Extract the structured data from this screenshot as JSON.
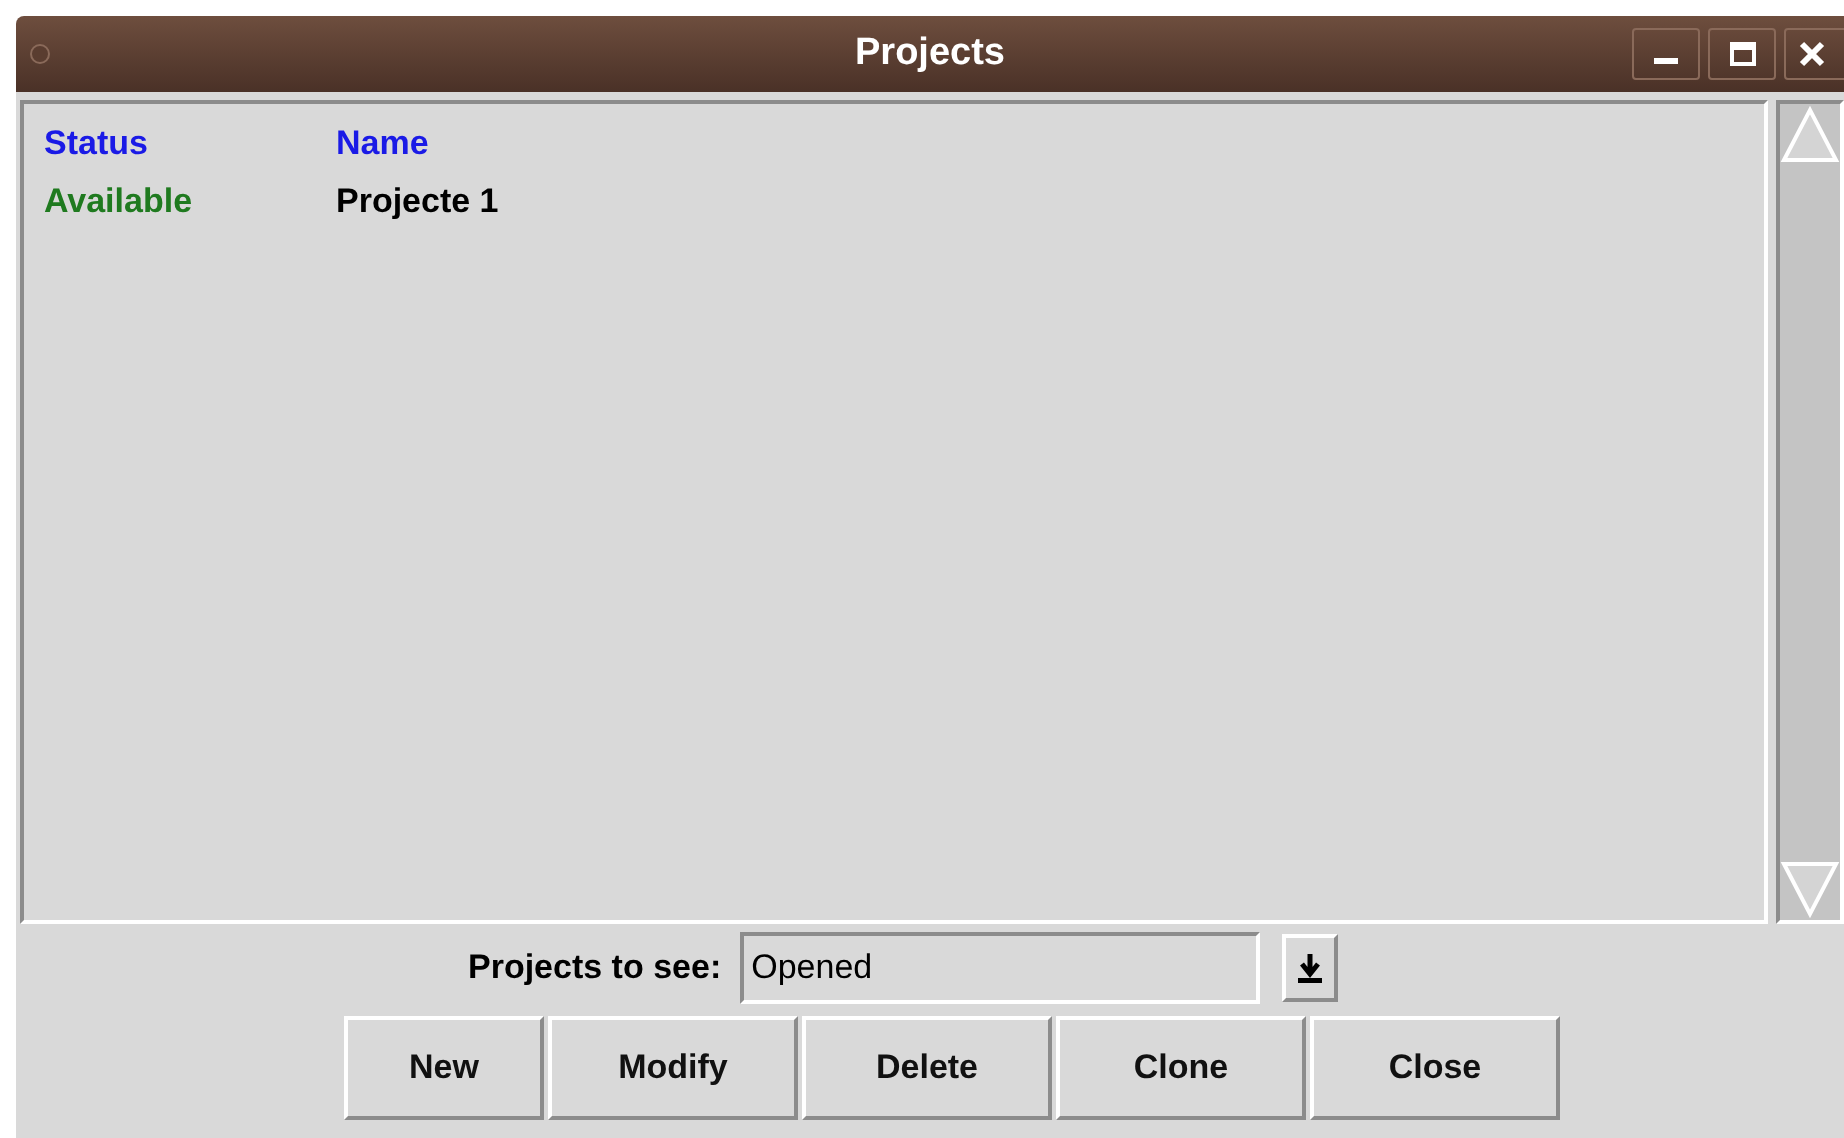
{
  "window": {
    "title": "Projects"
  },
  "table": {
    "columns": [
      "Status",
      "Name"
    ],
    "rows": [
      {
        "status": "Available",
        "color": "#1f7a1f",
        "name": "Projecte 1"
      }
    ]
  },
  "filter": {
    "label": "Projects to see:",
    "value": "Opened"
  },
  "buttons": [
    "New",
    "Modify",
    "Delete",
    "Clone",
    "Close"
  ]
}
